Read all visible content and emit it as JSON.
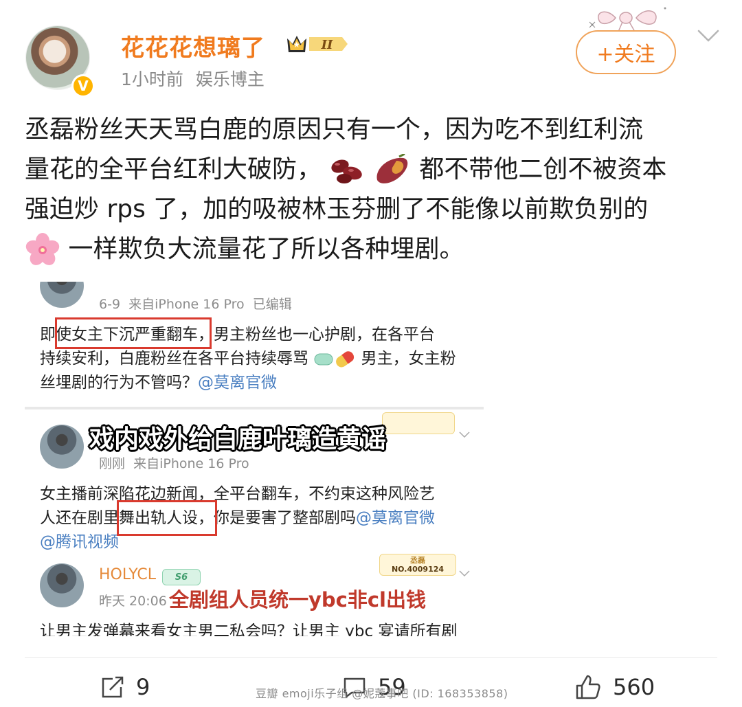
{
  "header": {
    "username": "花花花想璃了",
    "vip_level": "II",
    "time_ago": "1小时前",
    "user_tag": "娱乐博主",
    "follow_label": "+关注",
    "verified_mark": "V"
  },
  "post": {
    "line1": "丞磊粉丝天天骂白鹿的原因只有一个，因为吃不到红利流",
    "line2_a": "量花的全平台红利大破防，",
    "line2_b": "都不带他二创不被资本",
    "line3": "强迫炒 rps 了，加的吸被林玉芬删了不能像以前欺负别的",
    "line4": "一样欺负大流量花了所以各种埋剧。"
  },
  "embed": {
    "comment1": {
      "meta": "6-9  来自iPhone 16 Pro  已编辑",
      "line1_pre": "即",
      "line1_boxed": "使女主下沉严重翻车",
      "line1_post": "，男主粉丝也一心护剧，在各平台",
      "line2_a": "持续安利，白鹿粉丝在各平台持续辱骂",
      "line2_b": "男主，女主粉",
      "line3": "丝埋剧的行为不管吗？",
      "mention": "@莫离官微"
    },
    "overlay_top": "戏内戏外给白鹿叶璃造黄谣",
    "comment2": {
      "meta": "刚刚  来自iPhone 16 Pro",
      "line1": "女主播前深陷花边新闻，全平台翻车，不约束这种风险艺",
      "line2_pre": "人还在剧里",
      "line2_boxed": "舞出轨人设，",
      "line2_post": "你是要害了整部剧吗",
      "mention1": "@莫离官微",
      "mention2": "@腾讯视频"
    },
    "comment3": {
      "username": "HOLYCL",
      "level_tag": "S6",
      "fan_name": "丞磊",
      "fan_no": "NO.4009124",
      "time": "昨天 20:06",
      "overlay": "全剧组人员统一ybc非cl出钱",
      "cut_line": "让男主发弹幕来看女主男二私会吗？让男主 ybc 宴请所有剧"
    }
  },
  "actions": {
    "repost_count": "9",
    "comment_count": "59",
    "like_count": "560"
  },
  "watermark": "豆瓣  emoji乐子组 @妮蔻事吧 (ID: 168353858)",
  "colors": {
    "username": "#f07b1f",
    "mention": "#4a7fc1",
    "red_box": "#d93a2e"
  },
  "icons": [
    "verified-v-icon",
    "vip-crown-icon",
    "bow-decoration-icon",
    "chevron-down-icon",
    "kidney-beans-emoji",
    "sweet-potato-emoji",
    "cherry-blossom-emoji",
    "pill-emoji",
    "repost-icon",
    "comment-icon",
    "like-icon"
  ]
}
